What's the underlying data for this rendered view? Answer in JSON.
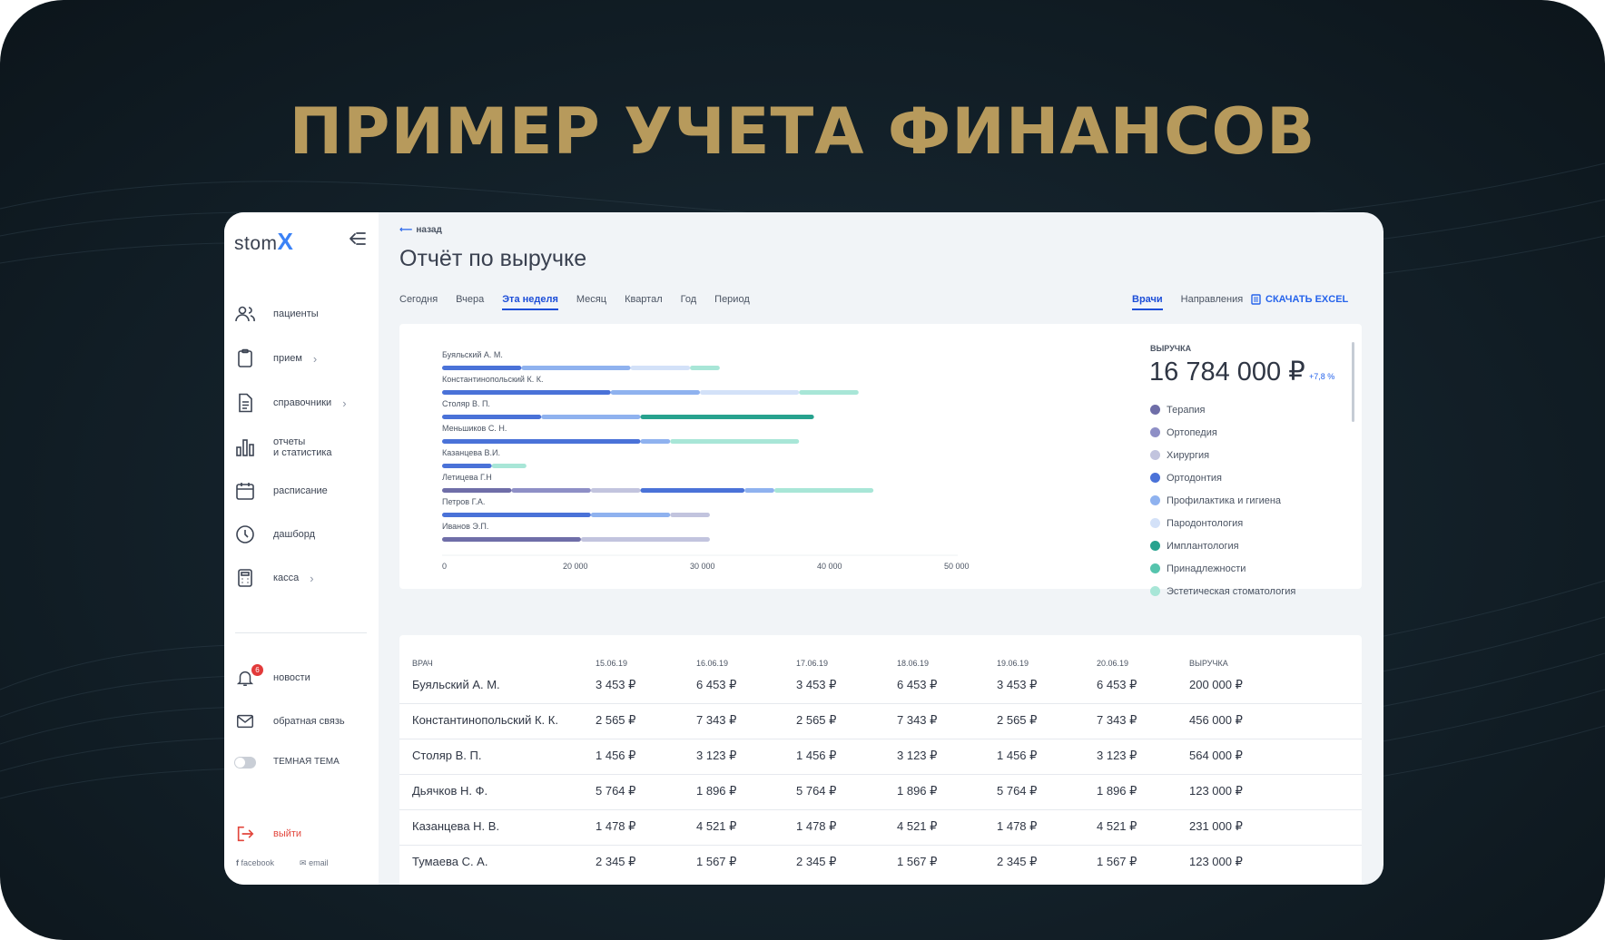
{
  "headline": "ПРИМЕР УЧЕТА ФИНАНСОВ",
  "colors": {
    "accent": "#2563eb",
    "headline": "#b79a5c",
    "danger": "#e2463c"
  },
  "sidebar": {
    "logo_text": "stom",
    "logo_x": "X",
    "items": [
      {
        "label": "пациенты",
        "icon": "users-icon",
        "chevron": ""
      },
      {
        "label": "прием",
        "icon": "clipboard-icon",
        "chevron": "›"
      },
      {
        "label": "справочники",
        "icon": "document-icon",
        "chevron": "›"
      },
      {
        "label": "отчеты\nи статистика",
        "icon": "bar-chart-icon",
        "chevron": ""
      },
      {
        "label": "расписание",
        "icon": "calendar-icon",
        "chevron": ""
      },
      {
        "label": "дашборд",
        "icon": "clock-icon",
        "chevron": ""
      },
      {
        "label": "касса",
        "icon": "calculator-icon",
        "chevron": "›"
      }
    ],
    "news_label": "новости",
    "news_badge": "6",
    "feedback_label": "обратная связь",
    "dark_theme_label": "ТЕМНАЯ ТЕМА",
    "logout_label": "выйти",
    "facebook_label": "facebook",
    "email_label": "email"
  },
  "main": {
    "back_label": "назад",
    "title": "Отчёт по выручке",
    "period_tabs": [
      "Сегодня",
      "Вчера",
      "Эта неделя",
      "Месяц",
      "Квартал",
      "Год",
      "Период"
    ],
    "active_period": "Эта неделя",
    "group_tabs": [
      "Врачи",
      "Направления"
    ],
    "active_group": "Врачи",
    "excel_label": "СКАЧАТЬ EXCEL"
  },
  "revenue": {
    "label": "ВЫРУЧКА",
    "total": "16 784 000 ₽",
    "delta": "+7,8 %"
  },
  "legend": [
    {
      "name": "Терапия",
      "color": "#6f6ea8"
    },
    {
      "name": "Ортопедия",
      "color": "#8e8fc6"
    },
    {
      "name": "Хирургия",
      "color": "#c2c4de"
    },
    {
      "name": "Ортодонтия",
      "color": "#4a72d8"
    },
    {
      "name": "Профилактика и гигиена",
      "color": "#8fb2ef"
    },
    {
      "name": "Пародонтология",
      "color": "#d3e1f8"
    },
    {
      "name": "Имплантология",
      "color": "#27a28e"
    },
    {
      "name": "Принадлежности",
      "color": "#56c4ad"
    },
    {
      "name": "Эстетическая стоматология",
      "color": "#a8e6d7"
    }
  ],
  "chart_data": {
    "type": "bar",
    "orientation": "horizontal",
    "stacked": true,
    "xlim": [
      0,
      52000
    ],
    "x_ticks": [
      "0",
      "20 000",
      "30 000",
      "40 000",
      "50 000"
    ],
    "categories": [
      "Буяльский А. М.",
      "Константинопольский К. К.",
      "Столяр В. П.",
      "Меньшиков С. Н.",
      "Казанцева В.И.",
      "Летицева Г.Н",
      "Петров Г.А.",
      "Иванов Э.П."
    ],
    "rows": [
      {
        "segments": [
          {
            "series": 3,
            "value": 8000
          },
          {
            "series": 4,
            "value": 11000
          },
          {
            "series": 5,
            "value": 6000
          },
          {
            "series": 8,
            "value": 3000
          }
        ]
      },
      {
        "segments": [
          {
            "series": 3,
            "value": 17000
          },
          {
            "series": 4,
            "value": 9000
          },
          {
            "series": 5,
            "value": 10000
          },
          {
            "series": 8,
            "value": 6000
          }
        ]
      },
      {
        "segments": [
          {
            "series": 3,
            "value": 10000
          },
          {
            "series": 4,
            "value": 10000
          },
          {
            "series": 6,
            "value": 17500
          }
        ]
      },
      {
        "segments": [
          {
            "series": 3,
            "value": 20000
          },
          {
            "series": 4,
            "value": 3000
          },
          {
            "series": 8,
            "value": 13000
          }
        ]
      },
      {
        "segments": [
          {
            "series": 3,
            "value": 5000
          },
          {
            "series": 8,
            "value": 3500
          }
        ]
      },
      {
        "segments": [
          {
            "series": 0,
            "value": 7000
          },
          {
            "series": 1,
            "value": 8000
          },
          {
            "series": 2,
            "value": 5000
          },
          {
            "series": 3,
            "value": 10500
          },
          {
            "series": 4,
            "value": 3000
          },
          {
            "series": 8,
            "value": 10000
          }
        ]
      },
      {
        "segments": [
          {
            "series": 3,
            "value": 15000
          },
          {
            "series": 4,
            "value": 8000
          },
          {
            "series": 2,
            "value": 4000
          }
        ]
      },
      {
        "segments": [
          {
            "series": 0,
            "value": 14000
          },
          {
            "series": 2,
            "value": 13000
          }
        ]
      }
    ]
  },
  "table": {
    "headers": [
      "ВРАЧ",
      "15.06.19",
      "16.06.19",
      "17.06.19",
      "18.06.19",
      "19.06.19",
      "20.06.19",
      "ВЫРУЧКА"
    ],
    "rows": [
      [
        "Буяльский А. М.",
        "3 453 ₽",
        "6 453 ₽",
        "3 453 ₽",
        "6 453 ₽",
        "3 453 ₽",
        "6 453 ₽",
        "200 000 ₽"
      ],
      [
        "Константинопольский К. К.",
        "2 565 ₽",
        "7 343 ₽",
        "2 565 ₽",
        "7 343 ₽",
        "2 565 ₽",
        "7 343 ₽",
        "456 000 ₽"
      ],
      [
        "Столяр В. П.",
        "1 456 ₽",
        "3 123 ₽",
        "1 456 ₽",
        "3 123 ₽",
        "1 456 ₽",
        "3 123 ₽",
        "564 000 ₽"
      ],
      [
        "Дьячков Н. Ф.",
        "5 764 ₽",
        "1 896 ₽",
        "5 764 ₽",
        "1 896 ₽",
        "5 764 ₽",
        "1 896 ₽",
        "123 000 ₽"
      ],
      [
        "Казанцева Н. В.",
        "1 478 ₽",
        "4 521 ₽",
        "1 478 ₽",
        "4 521 ₽",
        "1 478 ₽",
        "4 521 ₽",
        "231 000 ₽"
      ],
      [
        "Тумаева С. А.",
        "2 345 ₽",
        "1 567 ₽",
        "2 345 ₽",
        "1 567 ₽",
        "2 345 ₽",
        "1 567 ₽",
        "123 000 ₽"
      ]
    ]
  }
}
